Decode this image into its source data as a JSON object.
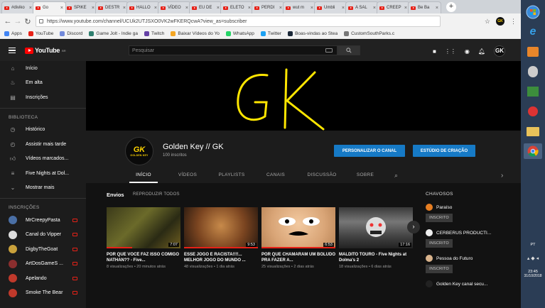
{
  "browser": {
    "tabs": [
      "#diviko",
      "Go",
      "SPIKE",
      "DESTR",
      "HALLO",
      "VÍDEO",
      "EU DE",
      "ELETO",
      "PERDI",
      "wut m",
      "Umbli",
      "A SAL",
      "CREEP",
      "Be Ba"
    ],
    "active_tab_index": 1,
    "url": "https://www.youtube.com/channel/UCUk2UTJSXO0VK2wFKERQcwA?view_as=subscriber",
    "bookmarks": [
      {
        "label": "Apps",
        "color": "#4285f4"
      },
      {
        "label": "YouTube",
        "color": "#e62117"
      },
      {
        "label": "Discord",
        "color": "#7289da"
      },
      {
        "label": "Game Jolt - Indie ga",
        "color": "#2f7f6f"
      },
      {
        "label": "Twitch",
        "color": "#6441a5"
      },
      {
        "label": "Baixar Vídeos do Yo",
        "color": "#f5a623"
      },
      {
        "label": "WhatsApp",
        "color": "#25d366"
      },
      {
        "label": "Twitter",
        "color": "#1da1f2"
      },
      {
        "label": "Boas-vindas ao Stea",
        "color": "#1b2838"
      },
      {
        "label": "CustomSouthParks.c",
        "color": "#777"
      }
    ]
  },
  "youtube": {
    "logo_text": "YouTube",
    "logo_suffix": "BR",
    "search_placeholder": "Pesquisar"
  },
  "sidebar": {
    "main": [
      {
        "label": "Início",
        "icon": "home-icon"
      },
      {
        "label": "Em alta",
        "icon": "fire-icon"
      },
      {
        "label": "Inscrições",
        "icon": "subscriptions-icon"
      }
    ],
    "library_heading": "BIBLIOTECA",
    "library": [
      {
        "label": "Histórico",
        "icon": "history-icon"
      },
      {
        "label": "Assistir mais tarde",
        "icon": "clock-icon"
      },
      {
        "label": "Vídeos marcados...",
        "icon": "thumbs-up-icon"
      },
      {
        "label": "Five Nights at Dol...",
        "icon": "playlist-icon"
      },
      {
        "label": "Mostrar mais",
        "icon": "chevron-down-icon"
      }
    ],
    "subs_heading": "INSCRIÇÕES",
    "subscriptions": [
      {
        "label": "MrCreepyPasta",
        "color": "#4a6fa5"
      },
      {
        "label": "Canal do Vipper",
        "color": "#ddd"
      },
      {
        "label": "DigbyTheGoat",
        "color": "#c9a13b"
      },
      {
        "label": "ArtDosGameS ...",
        "color": "#8b2e2e"
      },
      {
        "label": "Apelando",
        "color": "#c0392b"
      },
      {
        "label": "Smoke The Bear",
        "color": "#c0392b"
      }
    ]
  },
  "channel": {
    "banner_text": "GK",
    "avatar_initials": "GK",
    "avatar_sub": "GOLDEN KEY",
    "name": "Golden Key // GK",
    "subscribers": "100 inscritos",
    "customize_label": "PERSONALIZAR O CANAL",
    "studio_label": "ESTÚDIO DE CRIAÇÃO",
    "tabs": [
      "INÍCIO",
      "VÍDEOS",
      "PLAYLISTS",
      "CANAIS",
      "DISCUSSÃO",
      "SOBRE"
    ]
  },
  "uploads": {
    "title": "Envios",
    "play_all": "REPRODUZIR TODOS",
    "videos": [
      {
        "title": "POR QUE VOCÊ FAZ ISSO COMIGO NATHAN?? - Five...",
        "duration": "7:07",
        "views": "8 visualizações •",
        "age": "20 minutos atrás"
      },
      {
        "title": "ESSE JOGO É RACISTA!!!!... MELHOR JOGO DO MUNDO ...",
        "duration": "9:53",
        "views": "48 visualizações •",
        "age": "1 dia atrás"
      },
      {
        "title": "POR QUE CHAMARAM UM BOLUDO PRA FAZER A...",
        "duration": "6:53",
        "views": "25 visualizações •",
        "age": "2 dias atrás"
      },
      {
        "title": "MALDITO TOURO - Five Nights at Dolma's 2",
        "duration": "17:16",
        "views": "18 visualizações •",
        "age": "6 dias atrás"
      }
    ]
  },
  "related": {
    "heading": "CHAVOSOS",
    "channels": [
      {
        "name": "Paraíso",
        "button": "INSCRITO",
        "color": "#e67e22"
      },
      {
        "name": "CERBERUS PRODUCTI...",
        "button": "INSCRITO",
        "color": "#eee"
      },
      {
        "name": "Pessoa do Futuro",
        "button": "INSCRITO",
        "color": "#d9b38c"
      },
      {
        "name": "Golden Key canal secu...",
        "button": "",
        "color": "#222"
      }
    ]
  },
  "system": {
    "language": "PT",
    "time": "23:45",
    "date": "31/10/2018"
  }
}
